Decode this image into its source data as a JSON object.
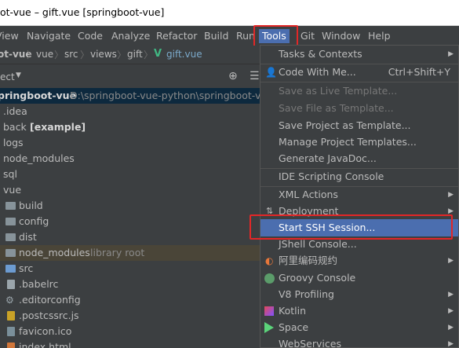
{
  "window": {
    "title": "ot-vue – gift.vue [springboot-vue]"
  },
  "menubar": {
    "items": [
      "View",
      "Navigate",
      "Code",
      "Analyze",
      "Refactor",
      "Build",
      "Run",
      "Tools",
      "Git",
      "Window",
      "Help"
    ],
    "active": "Tools"
  },
  "breadcrumb": {
    "items": [
      "ot-vue",
      "vue",
      "src",
      "views",
      "gift",
      "gift.vue"
    ]
  },
  "project_panel": {
    "title": "ect",
    "root_name": "pringboot-vue",
    "root_path": "D:\\springboot-vue-python\\springboot-vu",
    "rows": [
      {
        "label": ".idea"
      },
      {
        "label": "back",
        "extra": "[example]"
      },
      {
        "label": "logs"
      },
      {
        "label": "node_modules"
      },
      {
        "label": "sql"
      },
      {
        "label": "vue"
      },
      {
        "label": "build"
      },
      {
        "label": "config"
      },
      {
        "label": "dist"
      },
      {
        "label": "node_modules",
        "extra": "library root"
      },
      {
        "label": "src"
      },
      {
        "label": ".babelrc"
      },
      {
        "label": ".editorconfig"
      },
      {
        "label": ".postcssrc.js"
      },
      {
        "label": "favicon.ico"
      },
      {
        "label": "index.html"
      }
    ]
  },
  "tools_menu": {
    "items": [
      {
        "label": "Tasks & Contexts",
        "submenu": true
      },
      {
        "label": "Code With Me...",
        "shortcut": "Ctrl+Shift+Y"
      },
      {
        "label": "Save as Live Template...",
        "disabled": true
      },
      {
        "label": "Save File as Template...",
        "disabled": true
      },
      {
        "label": "Save Project as Template..."
      },
      {
        "label": "Manage Project Templates..."
      },
      {
        "label": "Generate JavaDoc..."
      },
      {
        "label": "IDE Scripting Console"
      },
      {
        "label": "XML Actions",
        "submenu": true
      },
      {
        "label": "Deployment",
        "submenu": true
      },
      {
        "label": "Start SSH Session...",
        "highlighted": true
      },
      {
        "label": "JShell Console..."
      },
      {
        "label": "阿里编码规约",
        "submenu": true
      },
      {
        "label": "Groovy Console"
      },
      {
        "label": "V8 Profiling",
        "submenu": true
      },
      {
        "label": "Kotlin",
        "submenu": true
      },
      {
        "label": "Space",
        "submenu": true
      },
      {
        "label": "WebServices",
        "submenu": true
      }
    ]
  },
  "colors": {
    "accent": "#4b6eaf",
    "annotation": "#e22727",
    "background": "#3c3f41"
  }
}
